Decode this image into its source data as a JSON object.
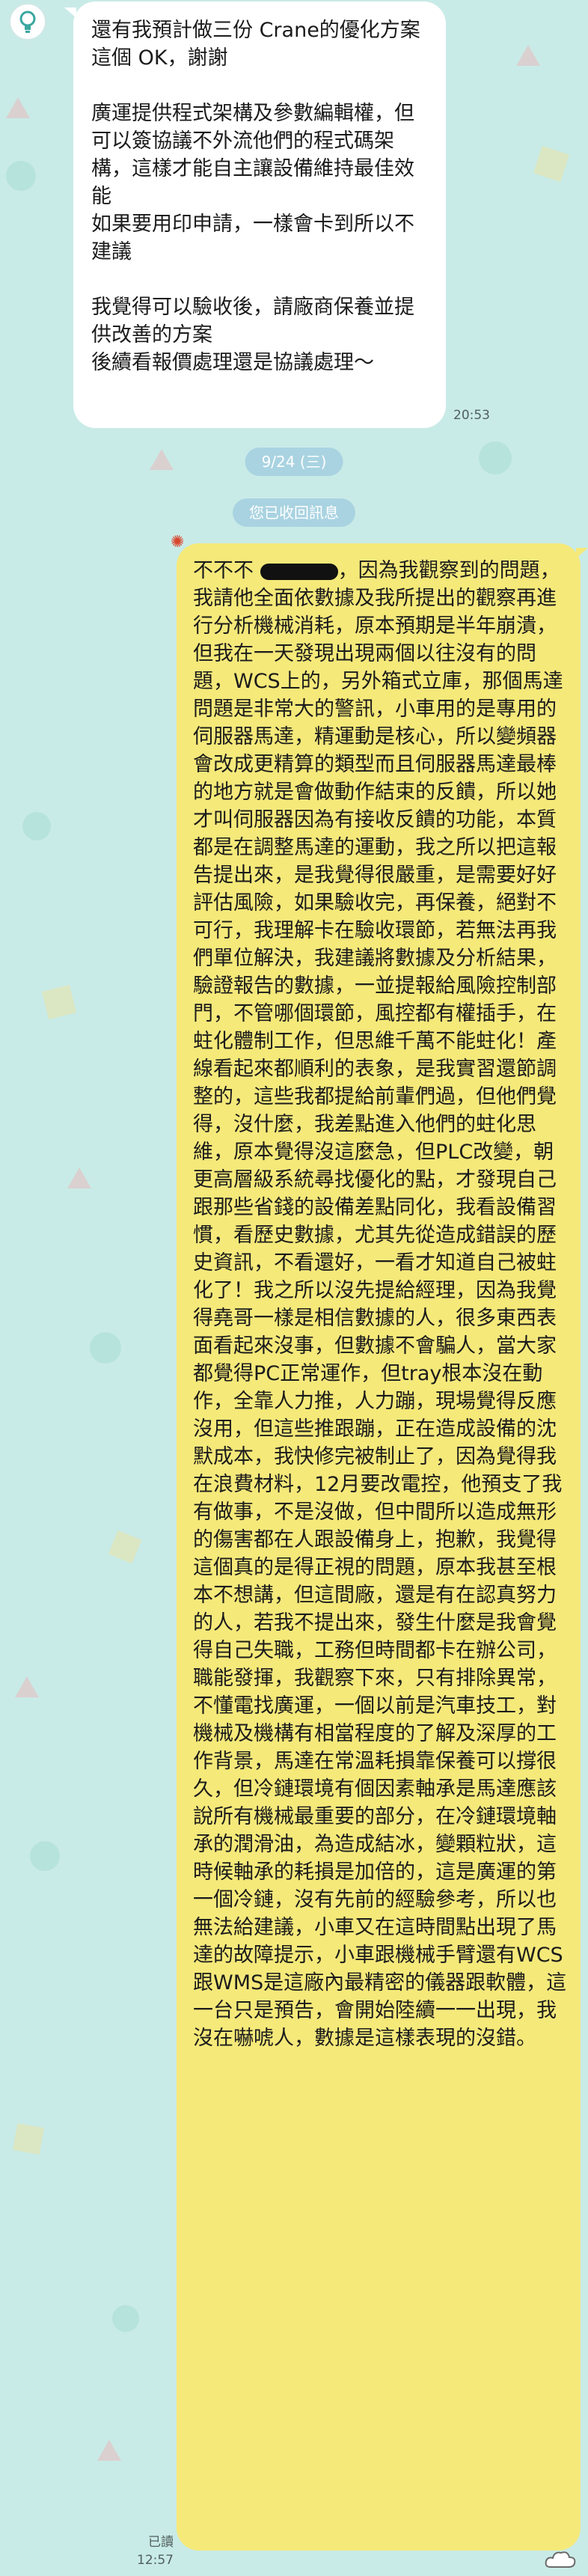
{
  "chat": {
    "incoming_message": {
      "text": "還有我預計做三份 Crane的優化方案\n這個 OK，謝謝\n\n廣運提供程式架構及參數編輯權，但可以簽協議不外流他們的程式碼架構，這樣才能自主讓設備維持最佳效能\n如果要用印申請，一樣會卡到所以不建議\n\n我覺得可以驗收後，請廠商保養並提供改善的方案\n後續看報價處理還是協議處理～",
      "time": "20:53"
    },
    "date_separator": "9/24 (三)",
    "recalled_notice": "您已收回訊息",
    "outgoing_message": {
      "text_prefix": "不不不 ",
      "text_body": "，因為我觀察到的問題，我請他全面依數據及我所提出的觀察再進行分析機械消耗，原本預期是半年崩潰，但我在一天發現出現兩個以往沒有的問題，WCS上的，另外箱式立庫，那個馬達問題是非常大的警訊，小車用的是專用的伺服器馬達，精運動是核心，所以變頻器會改成更精算的類型而且伺服器馬達最棒的地方就是會做動作結束的反饋，所以她才叫伺服器因為有接收反饋的功能，本質都是在調整馬達的運動，我之所以把這報告提出來，是我覺得很嚴重，是需要好好評估風險，如果驗收完，再保養，絕對不可行，我理解卡在驗收環節，若無法再我們單位解決，我建議將數據及分析結果，驗證報告的數據，一並提報給風險控制部門，不管哪個環節，風控都有權插手，在蛀化體制工作，但思維千萬不能蛀化！產線看起來都順利的表象，是我實習還節調整的，這些我都提給前輩們過，但他們覺得，沒什麼，我差點進入他們的蛀化思維，原本覺得沒這麼急，但PLC改變，朝更高層級系統尋找優化的點，才發現自己跟那些省錢的設備差點同化，我看設備習慣，看歷史數據，尤其先從造成錯誤的歷史資訊，不看還好，一看才知道自己被蛀化了！我之所以沒先提給經理，因為我覺得堯哥一樣是相信數據的人，很多東西表面看起來沒事，但數據不會騙人，當大家都覺得PC正常運作，但tray根本沒在動作，全靠人力推，人力蹦，現場覺得反應沒用，但這些推跟蹦，正在造成設備的沈默成本，我快修完被制止了，因為覺得我在浪費材料，12月要改電控，他預支了我有做事，不是沒做，但中間所以造成無形的傷害都在人跟設備身上，抱歉，我覺得這個真的是得正視的問題，原本我甚至根本不想講，但這間廠，還是有在認真努力的人，若我不提出來，發生什麼是我會覺得自己失職，工務但時間都卡在辦公司，職能發揮，我觀察下來，只有排除異常，不懂電找廣運，一個以前是汽車技工，對機械及機構有相當程度的了解及深厚的工作背景，馬達在常溫耗損靠保養可以撐很久，但冷鏈環境有個因素軸承是馬達應該說所有機械最重要的部分，在冷鏈環境軸承的潤滑油，為造成結冰，變顆粒狀，這時候軸承的耗損是加倍的，這是廣運的第一個冷鏈，沒有先前的經驗參考，所以也無法給建議，小車又在這時間點出現了馬達的故障提示，小車跟機械手臂還有WCS跟WMS是這廠內最精密的儀器跟軟體，這一台只是預告，會開始陸續一一出現，我沒在嚇唬人，數據是這樣表現的沒錯。",
      "read_label": "已讀",
      "time": "12:57"
    }
  },
  "icons": {
    "avatar": "bulb-avatar-icon",
    "status": "sun-flower-icon",
    "corner": "cloud-icon"
  },
  "colors": {
    "background": "#c9ebe7",
    "outgoing_bubble": "#f5e97a",
    "incoming_bubble": "#ffffff",
    "date_pill": "#a9d3e1"
  }
}
